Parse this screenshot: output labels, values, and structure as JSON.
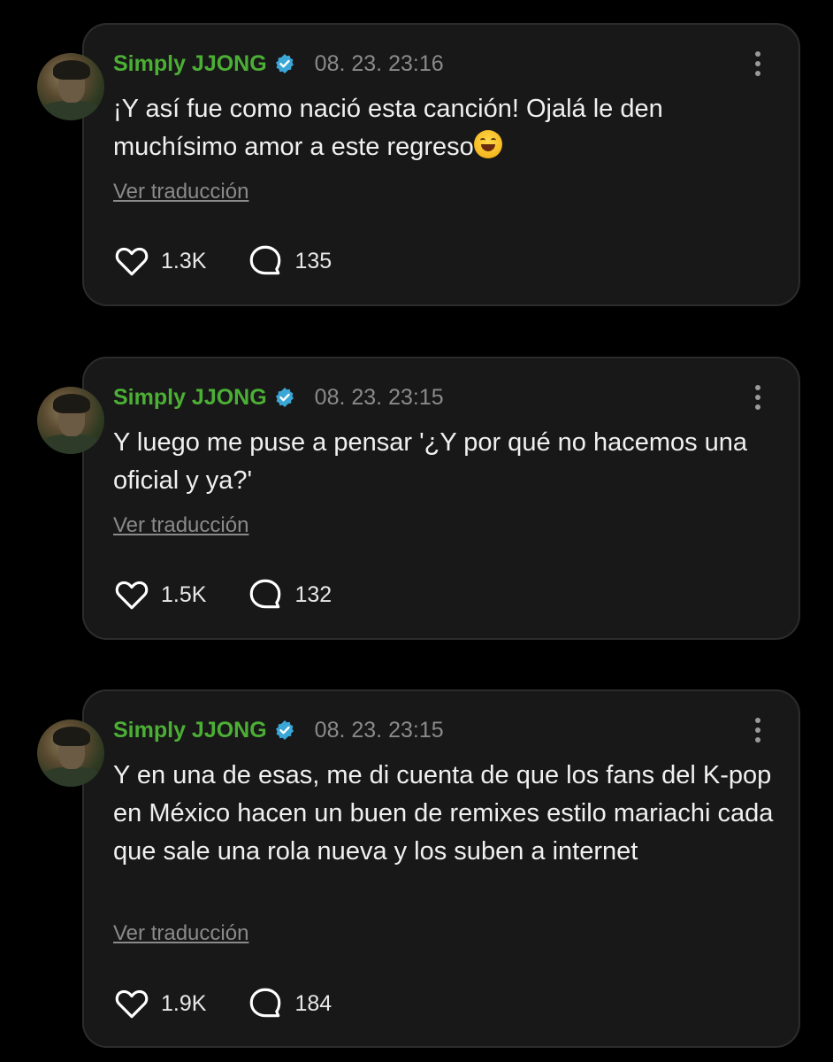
{
  "posts": [
    {
      "username": "Simply JJONG",
      "timestamp": "08. 23. 23:16",
      "text": "¡Y así fue como nació esta canción! Ojalá le den muchísimo amor a este regreso",
      "emoji": "😄",
      "translate_label": "Ver traducción",
      "likes": "1.3K",
      "comments": "135"
    },
    {
      "username": "Simply JJONG",
      "timestamp": "08. 23. 23:15",
      "text": "Y luego me puse a pensar '¿Y por qué no hacemos una oficial y ya?'",
      "translate_label": "Ver traducción",
      "likes": "1.5K",
      "comments": "132"
    },
    {
      "username": "Simply JJONG",
      "timestamp": "08. 23. 23:15",
      "text": "Y en una de esas, me di cuenta de que los fans del K-pop en México hacen un buen de remixes estilo mariachi cada que sale una rola nueva y los suben a internet",
      "translate_label": "Ver traducción",
      "likes": "1.9K",
      "comments": "184"
    }
  ],
  "colors": {
    "background": "#000000",
    "card": "#181818",
    "username": "#4caf35",
    "verified": "#3aa7d6",
    "muted": "#8a8a8a",
    "text": "#f0f0f0"
  },
  "icons": {
    "verified": "verified-badge-icon",
    "menu": "more-vertical-icon",
    "like": "heart-icon",
    "comment": "comment-bubble-icon"
  }
}
